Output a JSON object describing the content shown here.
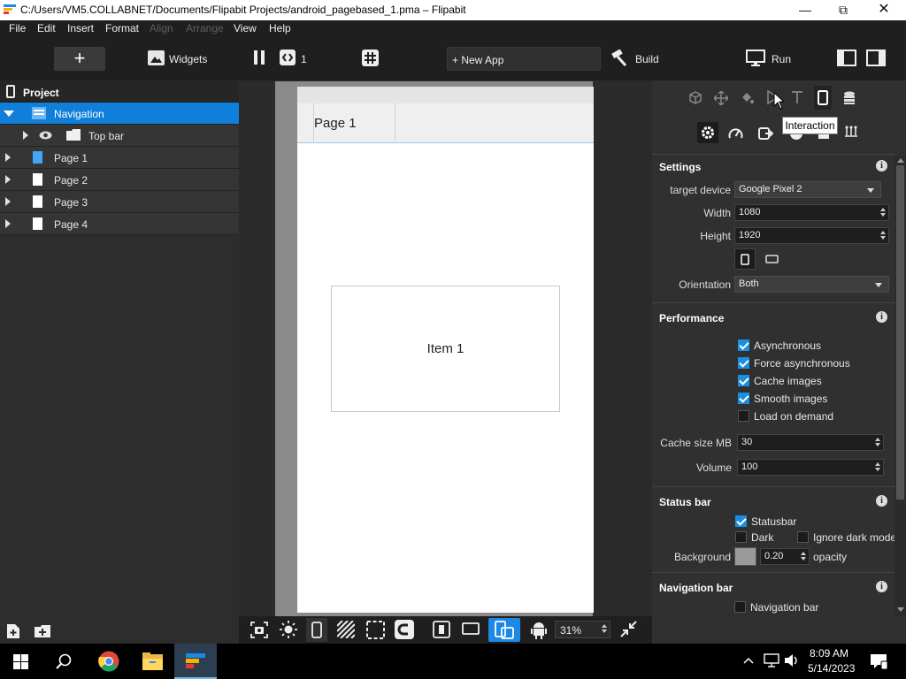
{
  "window": {
    "title": "C:/Users/VM5.COLLABNET/Documents/Flipabit Projects/android_pagebased_1.pma – Flipabit"
  },
  "menu": {
    "file": "File",
    "edit": "Edit",
    "insert": "Insert",
    "format": "Format",
    "align": "Align",
    "arrange": "Arrange",
    "view": "View",
    "help": "Help"
  },
  "toolbar": {
    "widgets": "Widgets",
    "pages_count": "1",
    "new_app": "+ New App",
    "build": "Build",
    "run": "Run"
  },
  "project": {
    "title": "Project",
    "tree": [
      {
        "label": "Navigation"
      },
      {
        "label": "Top bar"
      },
      {
        "label": "Page 1"
      },
      {
        "label": "Page 2"
      },
      {
        "label": "Page 3"
      },
      {
        "label": "Page 4"
      }
    ]
  },
  "canvas": {
    "tab_label": "Page 1",
    "item_label": "Item 1",
    "zoom": "31%"
  },
  "tooltip": "Interaction",
  "settings": {
    "title": "Settings",
    "target_device_label": "target device",
    "target_device": "Google Pixel 2",
    "width_label": "Width",
    "width": "1080",
    "height_label": "Height",
    "height": "1920",
    "orientation_label": "Orientation",
    "orientation": "Both"
  },
  "performance": {
    "title": "Performance",
    "options": [
      {
        "label": "Asynchronous",
        "checked": true
      },
      {
        "label": "Force asynchronous",
        "checked": true
      },
      {
        "label": "Cache images",
        "checked": true
      },
      {
        "label": "Smooth images",
        "checked": true
      },
      {
        "label": "Load on demand",
        "checked": false
      }
    ],
    "cache_label": "Cache size MB",
    "cache": "30",
    "volume_label": "Volume",
    "volume": "100"
  },
  "status_bar": {
    "title": "Status bar",
    "statusbar": "Statusbar",
    "dark": "Dark",
    "ignore_dark": "Ignore dark mode",
    "background_label": "Background",
    "opacity_value": "0.20",
    "opacity_label": "opacity"
  },
  "navigation_bar": {
    "title": "Navigation bar",
    "option": "Navigation bar"
  },
  "clock": {
    "time": "8:09 AM",
    "date": "5/14/2023"
  },
  "colors": {
    "accent": "#0f7fd9",
    "panel": "#2d2d2d",
    "toolbar": "#1f1f1f"
  }
}
